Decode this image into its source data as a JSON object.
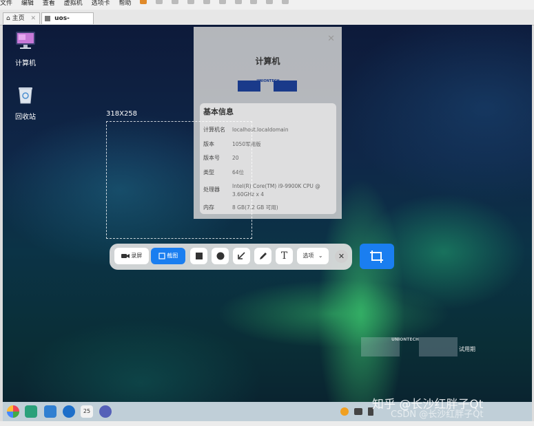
{
  "menubar": {
    "items": [
      "文件",
      "编辑",
      "查看",
      "虚拟机",
      "选项卡",
      "帮助"
    ]
  },
  "tabs": [
    {
      "label": "主页"
    },
    {
      "label": "uos-server"
    }
  ],
  "desktop_icons": [
    {
      "label": "计算机",
      "icon": "computer-icon"
    },
    {
      "label": "回收站",
      "icon": "trash-icon"
    }
  ],
  "selection": {
    "size_label": "318X258"
  },
  "dialog": {
    "title": "计算机",
    "logo_text": "UNIONTECH",
    "info_heading": "基本信息",
    "rows": [
      {
        "key": "计算机名",
        "value": "localhost.localdomain"
      },
      {
        "key": "版本",
        "value": "1050军用版"
      },
      {
        "key": "版本号",
        "value": "20"
      },
      {
        "key": "类型",
        "value": "64位"
      },
      {
        "key": "处理器",
        "value": "Intel(R) Core(TM) i9-9900K CPU @ 3.60GHz x 4"
      },
      {
        "key": "内存",
        "value": "8 GB(7.2 GB 可用)"
      }
    ]
  },
  "toolbar": {
    "record_label": "录屏",
    "screenshot_label": "截图",
    "options_label": "选项",
    "accent": "#1a7ef0"
  },
  "watermark_logo": {
    "text": "UNIONTECH",
    "trial": "试用期"
  },
  "taskbar": {
    "date": "25"
  },
  "overlay": {
    "zhihu": "知乎 @长沙红胖子Qt",
    "csdn": "CSDN @长沙红胖子Qt"
  }
}
